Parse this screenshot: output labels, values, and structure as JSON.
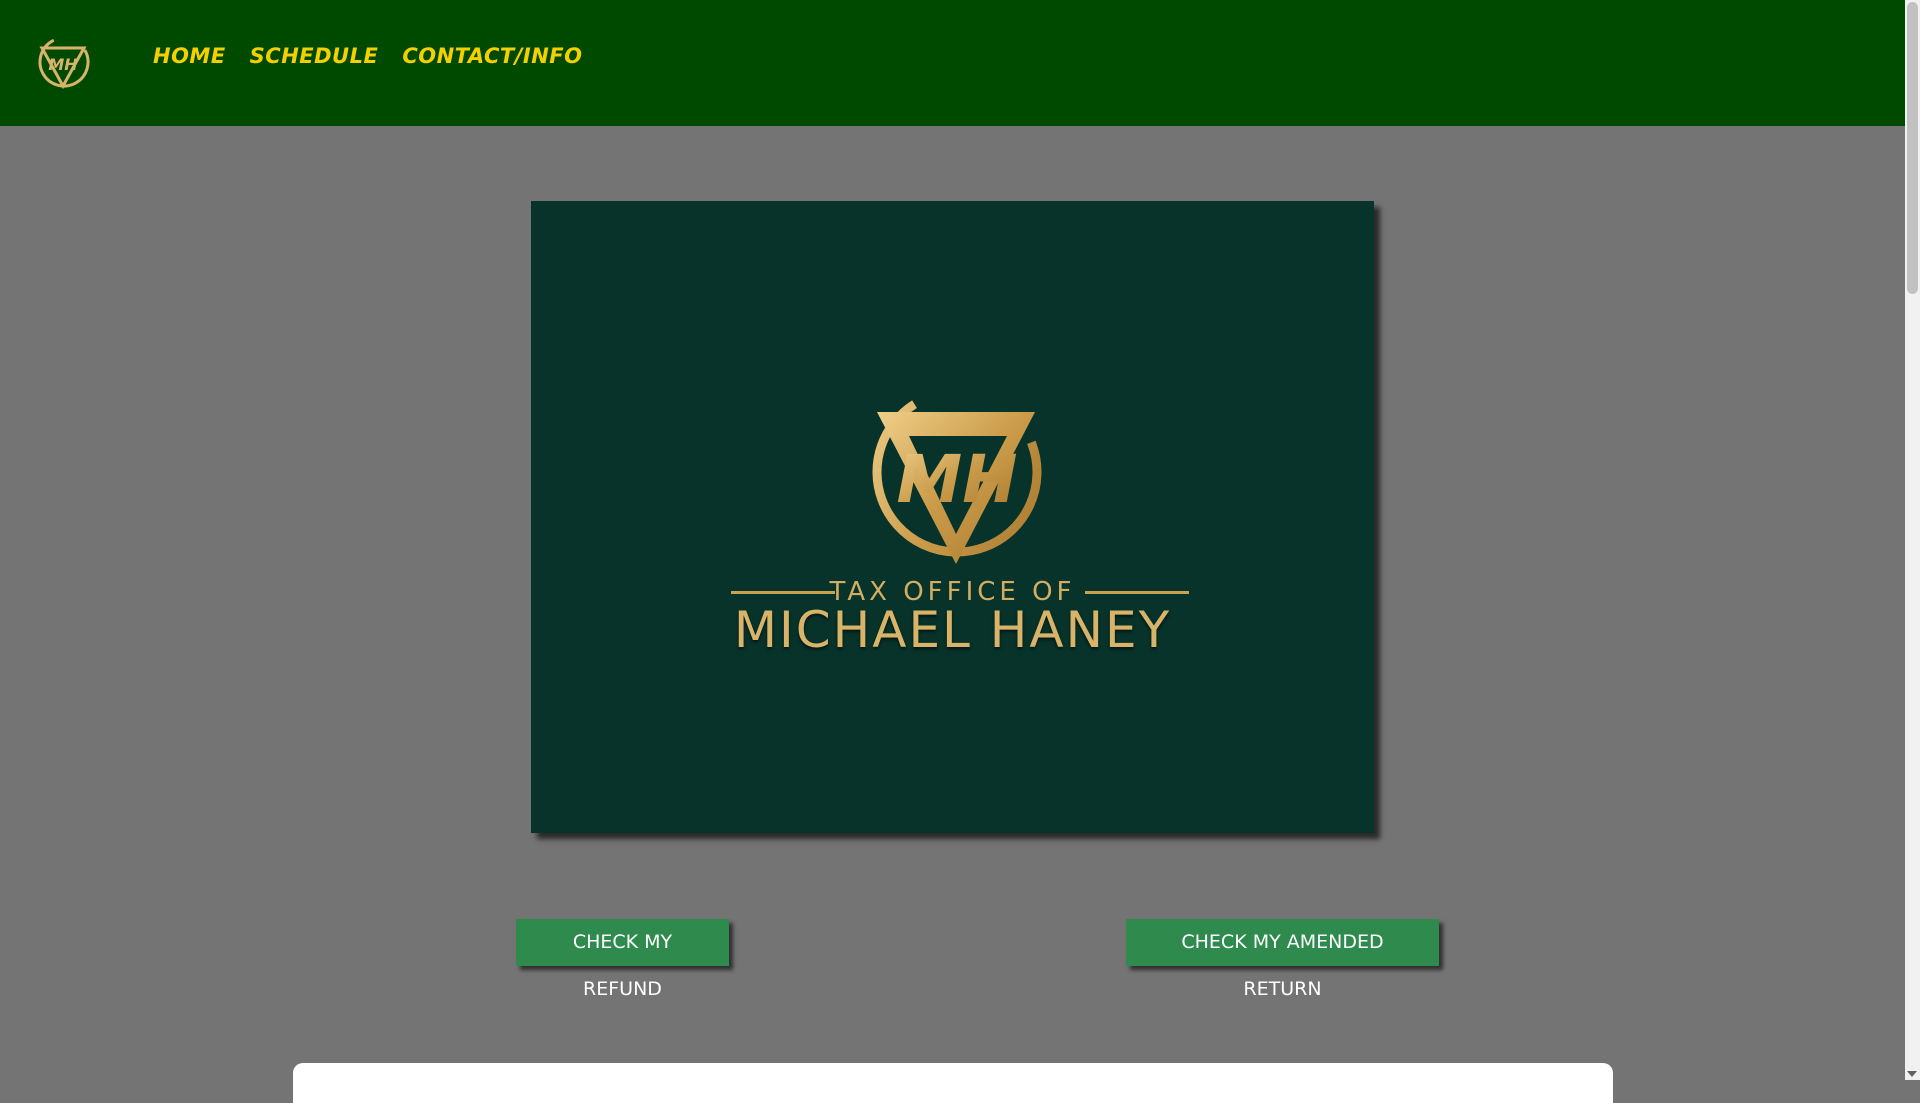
{
  "nav": {
    "logo_icon": "mh-monogram-icon",
    "links": [
      "HOME",
      "SCHEDULE",
      "CONTACT/INFO"
    ]
  },
  "hero": {
    "logo_icon": "mh-monogram-triangle-icon",
    "subtitle": "TAX OFFICE OF",
    "title": "MICHAEL HANEY"
  },
  "actions": {
    "refund_label": "CHECK MY REFUND",
    "amended_label": "CHECK MY AMENDED RETURN"
  },
  "colors": {
    "nav_bg": "#004a00",
    "nav_link": "#f5d000",
    "page_bg": "#747474",
    "hero_bg": "#07332a",
    "gold": "#d2ad62",
    "button_bg": "#2e8b4d"
  }
}
